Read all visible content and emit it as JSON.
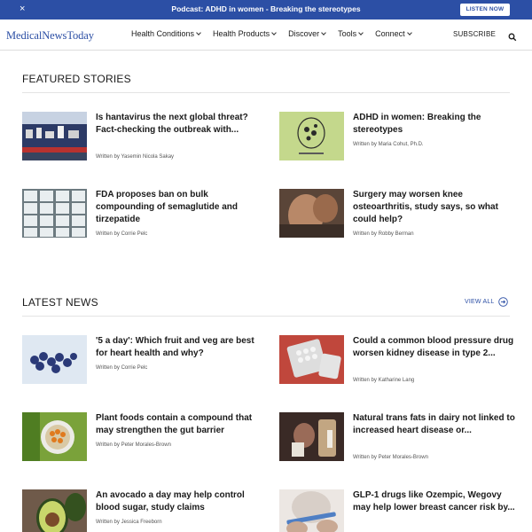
{
  "promo": {
    "close_glyph": "×",
    "text": "Podcast: ADHD in women - Breaking the stereotypes",
    "button_label": "LISTEN NOW"
  },
  "nav": {
    "logo": "MedicalNewsToday",
    "menu": [
      "Health Conditions",
      "Health Products",
      "Discover",
      "Tools",
      "Connect"
    ],
    "subscribe_label": "SUBSCRIBE",
    "search_icon": "search-icon"
  },
  "featured": {
    "title": "FEATURED STORIES",
    "stories": [
      {
        "title": "Is hantavirus the next global threat? Fact-checking the outbreak with...",
        "byline": "Written by Yasemin Nicola Sakay"
      },
      {
        "title": "ADHD in women: Breaking the stereotypes",
        "byline": "Written by Maria Cohut, Ph.D."
      },
      {
        "title": "FDA proposes ban on bulk compounding of semaglutide and tirzepatide",
        "byline": "Written by Corrie Pelc"
      },
      {
        "title": "Surgery may worsen knee osteoarthritis, study says, so what could help?",
        "byline": "Written by Robby Berman"
      }
    ]
  },
  "latest": {
    "title": "LATEST NEWS",
    "view_all_label": "VIEW ALL",
    "stories": [
      {
        "title": "'5 a day': Which fruit and veg are best for heart health and why?",
        "byline": "Written by Corrie Pelc"
      },
      {
        "title": "Could a common blood pressure drug worsen kidney disease in type 2...",
        "byline": "Written by Katharine Lang"
      },
      {
        "title": "Plant foods contain a compound that may strengthen the gut barrier",
        "byline": "Written by Peter Morales-Brown"
      },
      {
        "title": "Natural trans fats in dairy not linked to increased heart disease or...",
        "byline": "Written by Peter Morales-Brown"
      },
      {
        "title": "An avocado a day may help control blood sugar, study claims",
        "byline": "Written by Jessica Freeborn"
      },
      {
        "title": "GLP-1 drugs like Ozempic, Wegovy may help lower breast cancer risk by...",
        "byline": ""
      }
    ]
  },
  "colors": {
    "brand_blue": "#2c4fa5",
    "text": "#1a1a1a",
    "divider": "#e4e4e4"
  }
}
